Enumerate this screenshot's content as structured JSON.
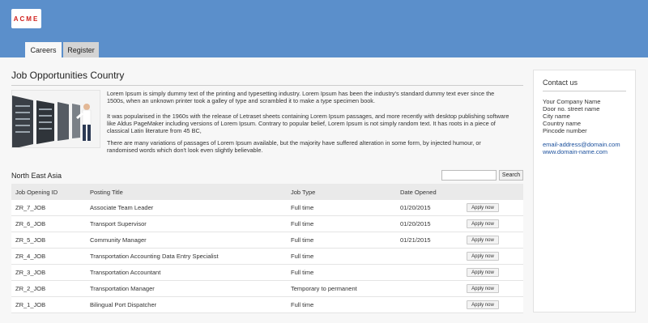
{
  "brand": {
    "logo_text": "ACME"
  },
  "tabs": [
    {
      "label": "Careers",
      "active": true
    },
    {
      "label": "Register",
      "active": false
    }
  ],
  "main": {
    "title": "Job Opportunities Country",
    "paragraphs": [
      "Lorem Ipsum is simply dummy text of the printing and typesetting industry. Lorem Ipsum has been the industry's standard dummy text ever since the 1500s, when an unknown printer took a galley of type and scrambled it to make a type specimen book.",
      "It was popularised in the 1960s with the release of Letraset sheets containing Lorem Ipsum passages, and more recently with desktop publishing software like Aldus PageMaker including versions of Lorem Ipsum. Contrary to popular belief, Lorem Ipsum is not simply random text. It has roots in a piece of classical Latin literature from 45 BC,",
      "There are many variations of passages of Lorem Ipsum available, but the majority have suffered alteration in some form, by injected humour, or randomised words which don't look even slightly believable."
    ],
    "region": "North East Asia",
    "search": {
      "value": "",
      "button_label": "Search"
    }
  },
  "table": {
    "columns": [
      "Job Opening ID",
      "Posting Title",
      "Job Type",
      "Date Opened",
      ""
    ],
    "rows": [
      {
        "id": "ZR_7_JOB",
        "title": "Associate Team Leader",
        "type": "Full time",
        "date": "01/20/2015",
        "action": "Apply now"
      },
      {
        "id": "ZR_6_JOB",
        "title": "Transport Supervisor",
        "type": "Full time",
        "date": "01/20/2015",
        "action": "Apply now"
      },
      {
        "id": "ZR_5_JOB",
        "title": "Community Manager",
        "type": "Full time",
        "date": "01/21/2015",
        "action": "Apply now"
      },
      {
        "id": "ZR_4_JOB",
        "title": "Transportation Accounting Data Entry Specialist",
        "type": "Full time",
        "date": "",
        "action": "Apply now"
      },
      {
        "id": "ZR_3_JOB",
        "title": "Transportation Accountant",
        "type": "Full time",
        "date": "",
        "action": "Apply now"
      },
      {
        "id": "ZR_2_JOB",
        "title": "Transportation Manager",
        "type": "Temporary to permanent",
        "date": "",
        "action": "Apply now"
      },
      {
        "id": "ZR_1_JOB",
        "title": "Bilingual Port Dispatcher",
        "type": "Full time",
        "date": "",
        "action": "Apply now"
      }
    ]
  },
  "contact": {
    "title": "Contact us",
    "lines": [
      "Your Company Name",
      "Door no. street name",
      "City name",
      "Country name",
      "Pincode number"
    ],
    "email": "email-address@domain.com",
    "website": "www.domain-name.com"
  },
  "colors": {
    "header_bg": "#5b8fcb",
    "logo_red": "#d0201c",
    "link": "#1a4f9c"
  }
}
